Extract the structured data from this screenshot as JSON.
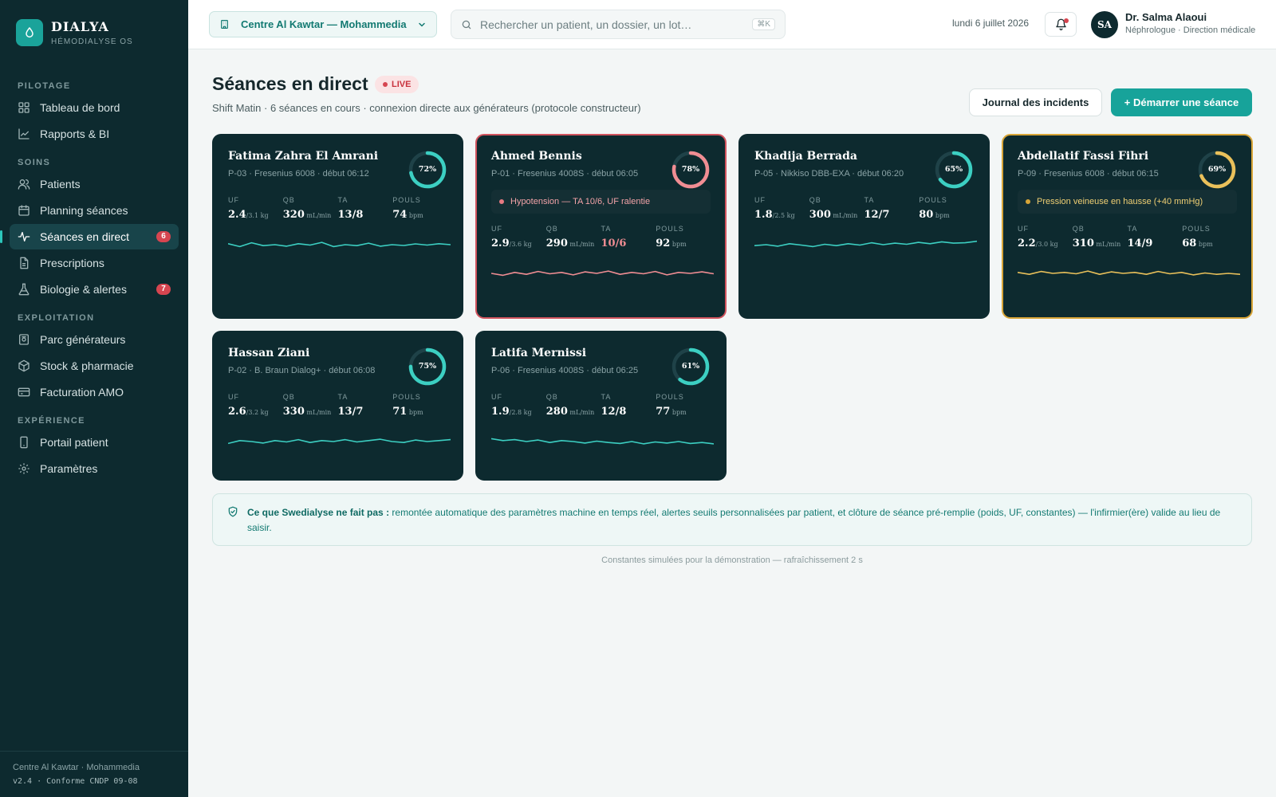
{
  "brand": {
    "name": "DIALYA",
    "subtitle": "HÉMODIALYSE OS",
    "accent": "#1aa39a"
  },
  "sidebar": {
    "sections": [
      {
        "title": "PILOTAGE",
        "items": [
          {
            "label": "Tableau de bord",
            "icon": "grid-icon"
          },
          {
            "label": "Rapports & BI",
            "icon": "chart-icon"
          }
        ]
      },
      {
        "title": "SOINS",
        "items": [
          {
            "label": "Patients",
            "icon": "users-icon"
          },
          {
            "label": "Planning séances",
            "icon": "calendar-icon"
          },
          {
            "label": "Séances en direct",
            "icon": "pulse-icon",
            "active": true,
            "badge": "6"
          },
          {
            "label": "Prescriptions",
            "icon": "document-icon"
          },
          {
            "label": "Biologie & alertes",
            "icon": "flask-icon",
            "badge": "7"
          }
        ]
      },
      {
        "title": "EXPLOITATION",
        "items": [
          {
            "label": "Parc générateurs",
            "icon": "machine-icon"
          },
          {
            "label": "Stock & pharmacie",
            "icon": "box-icon"
          },
          {
            "label": "Facturation AMO",
            "icon": "card-icon"
          }
        ]
      },
      {
        "title": "EXPÉRIENCE",
        "items": [
          {
            "label": "Portail patient",
            "icon": "phone-icon"
          },
          {
            "label": "Paramètres",
            "icon": "gear-icon"
          }
        ]
      }
    ],
    "footer": {
      "line1": "Centre Al Kawtar · Mohammedia",
      "line2": "v2.4 · Conforme CNDP 09-08"
    }
  },
  "topbar": {
    "center": "Centre Al Kawtar — Mohammedia",
    "search_placeholder": "Rechercher un patient, un dossier, un lot…",
    "search_shortcut": "⌘K",
    "date": "lundi 6 juillet 2026",
    "user": {
      "initials": "SA",
      "name": "Dr. Salma Alaoui",
      "role": "Néphrologue · Direction médicale"
    }
  },
  "header": {
    "title": "Séances en direct",
    "live": "LIVE",
    "subtitle": "Shift Matin · 6 séances en cours · connexion directe aux générateurs (protocole constructeur)",
    "btn_incidents": "Journal des incidents",
    "btn_start": "+ Démarrer une séance"
  },
  "metric_labels": {
    "uf": "UF",
    "qb": "QB",
    "ta": "TA",
    "pouls": "POULS"
  },
  "units": {
    "uf_prefix": "/",
    "uf_suffix": " kg",
    "qb": " mL/min",
    "pouls": " bpm"
  },
  "sessions": [
    {
      "name": "Fatima Zahra El Amrani",
      "meta": "P-03 · Fresenius 6008 · début 06:12",
      "progress": 72,
      "progress_label": "72%",
      "uf": "2.4",
      "uf_target": "3.1",
      "qb": "320",
      "ta": "13/8",
      "pouls": "74",
      "status": "normal",
      "alert": null,
      "color": "#3ccfc2",
      "trend": [
        0.55,
        0.4,
        0.6,
        0.45,
        0.5,
        0.42,
        0.55,
        0.48,
        0.62,
        0.4,
        0.5,
        0.45,
        0.58,
        0.42,
        0.5,
        0.46,
        0.54,
        0.48,
        0.55,
        0.5
      ]
    },
    {
      "name": "Ahmed Bennis",
      "meta": "P-01 · Fresenius 4008S · début 06:05",
      "progress": 78,
      "progress_label": "78%",
      "uf": "2.9",
      "uf_target": "3.6",
      "qb": "290",
      "ta": "10/6",
      "pouls": "92",
      "status": "critical",
      "alert": "Hypotension — TA 10/6, UF ralentie",
      "color": "#f08d93",
      "trend": [
        0.5,
        0.4,
        0.55,
        0.45,
        0.6,
        0.48,
        0.55,
        0.42,
        0.58,
        0.5,
        0.62,
        0.45,
        0.55,
        0.48,
        0.6,
        0.42,
        0.55,
        0.5,
        0.58,
        0.48
      ]
    },
    {
      "name": "Khadija Berrada",
      "meta": "P-05 · Nikkiso DBB-EXA · début 06:20",
      "progress": 65,
      "progress_label": "65%",
      "uf": "1.8",
      "uf_target": "2.5",
      "qb": "300",
      "ta": "12/7",
      "pouls": "80",
      "status": "normal",
      "alert": null,
      "color": "#3ccfc2",
      "trend": [
        0.45,
        0.5,
        0.42,
        0.55,
        0.48,
        0.4,
        0.52,
        0.45,
        0.55,
        0.48,
        0.6,
        0.5,
        0.58,
        0.52,
        0.62,
        0.55,
        0.65,
        0.58,
        0.6,
        0.68
      ]
    },
    {
      "name": "Abdellatif Fassi Fihri",
      "meta": "P-09 · Fresenius 6008 · début 06:15",
      "progress": 69,
      "progress_label": "69%",
      "uf": "2.2",
      "uf_target": "3.0",
      "qb": "310",
      "ta": "14/9",
      "pouls": "68",
      "status": "warning",
      "alert": "Pression veineuse en hausse (+40 mmHg)",
      "color": "#e9c05a",
      "trend": [
        0.55,
        0.45,
        0.6,
        0.5,
        0.55,
        0.48,
        0.62,
        0.45,
        0.58,
        0.5,
        0.55,
        0.45,
        0.6,
        0.48,
        0.55,
        0.42,
        0.52,
        0.45,
        0.5,
        0.45
      ]
    },
    {
      "name": "Hassan Ziani",
      "meta": "P-02 · B. Braun Dialog+ · début 06:08",
      "progress": 75,
      "progress_label": "75%",
      "uf": "2.6",
      "uf_target": "3.2",
      "qb": "330",
      "ta": "13/7",
      "pouls": "71",
      "status": "normal",
      "alert": null,
      "color": "#3ccfc2",
      "trend": [
        0.4,
        0.55,
        0.5,
        0.42,
        0.55,
        0.48,
        0.6,
        0.45,
        0.55,
        0.5,
        0.6,
        0.48,
        0.55,
        0.62,
        0.5,
        0.45,
        0.58,
        0.5,
        0.55,
        0.6
      ]
    },
    {
      "name": "Latifa Mernissi",
      "meta": "P-06 · Fresenius 4008S · début 06:25",
      "progress": 61,
      "progress_label": "61%",
      "uf": "1.9",
      "uf_target": "2.8",
      "qb": "280",
      "ta": "12/8",
      "pouls": "77",
      "status": "normal",
      "alert": null,
      "color": "#3ccfc2",
      "trend": [
        0.65,
        0.55,
        0.6,
        0.5,
        0.58,
        0.45,
        0.55,
        0.5,
        0.42,
        0.52,
        0.45,
        0.4,
        0.5,
        0.38,
        0.48,
        0.42,
        0.5,
        0.4,
        0.45,
        0.38
      ]
    }
  ],
  "note": {
    "lead": "Ce que Swedialyse ne fait pas :",
    "text": "remontée automatique des paramètres machine en temps réel, alertes seuils personnalisées par patient, et clôture de séance pré-remplie (poids, UF, constantes) — l'infirmier(ère) valide au lieu de saisir."
  },
  "footnote": "Constantes simulées pour la démonstration — rafraîchissement 2 s"
}
